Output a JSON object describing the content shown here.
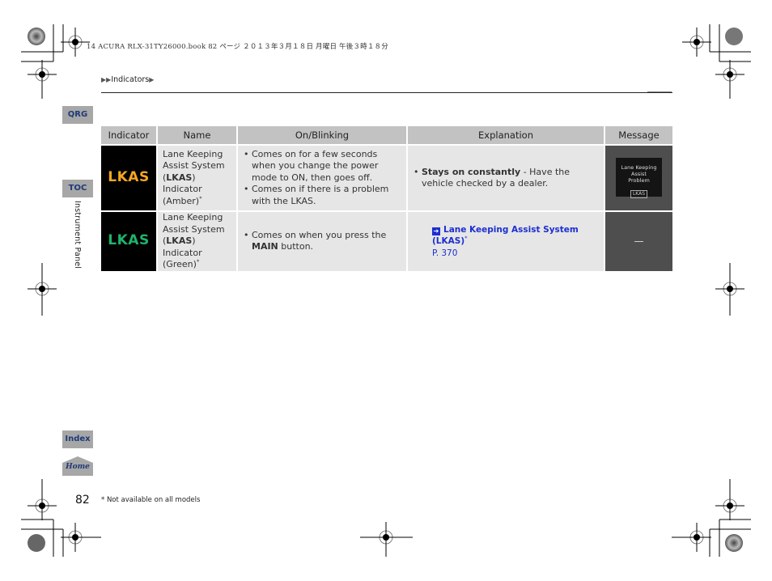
{
  "print_header": "14 ACURA RLX-31TY26000.book  82 ページ  ２０１３年３月１８日  月曜日  午後３時１８分",
  "breadcrumb": {
    "prefix": "▶▶",
    "label": "Indicators",
    "suffix": "▶"
  },
  "nav": {
    "qrg": "QRG",
    "toc": "TOC",
    "index": "Index",
    "home": "Home",
    "section": "Instrument Panel"
  },
  "table": {
    "headers": [
      "Indicator",
      "Name",
      "On/Blinking",
      "Explanation",
      "Message"
    ],
    "rows": [
      {
        "indicator": {
          "text": "LKAS",
          "color": "#f5a623"
        },
        "name": {
          "pre": "Lane Keeping Assist System (",
          "bold": "LKAS",
          "post": ") Indicator (Amber)",
          "mark": "*"
        },
        "on_blinking": [
          "Comes on for a few seconds when you change the power mode to ON, then goes off.",
          "Comes on if there is a problem with the LKAS."
        ],
        "explanation": {
          "bold": "Stays on constantly",
          "rest": " - Have the vehicle checked by a dealer."
        },
        "message": {
          "line1": "Lane Keeping Assist",
          "line2": "Problem",
          "badge": "LKAS"
        }
      },
      {
        "indicator": {
          "text": "LKAS",
          "color": "#1fb36b"
        },
        "name": {
          "pre": "Lane Keeping Assist System (",
          "bold": "LKAS",
          "post": ") Indicator (Green)",
          "mark": "*"
        },
        "on_blinking": {
          "pre": "Comes on when you press the ",
          "bold": "MAIN",
          "post": " button."
        },
        "explanation": {
          "link_icon": "arrow-right-icon",
          "link_text": "Lane Keeping Assist System (LKAS)",
          "link_mark": "*",
          "page_ref": "P. 370"
        },
        "message": {
          "text": "—"
        }
      }
    ]
  },
  "footer": {
    "page_number": "82",
    "footnote": "* Not available on all models"
  }
}
